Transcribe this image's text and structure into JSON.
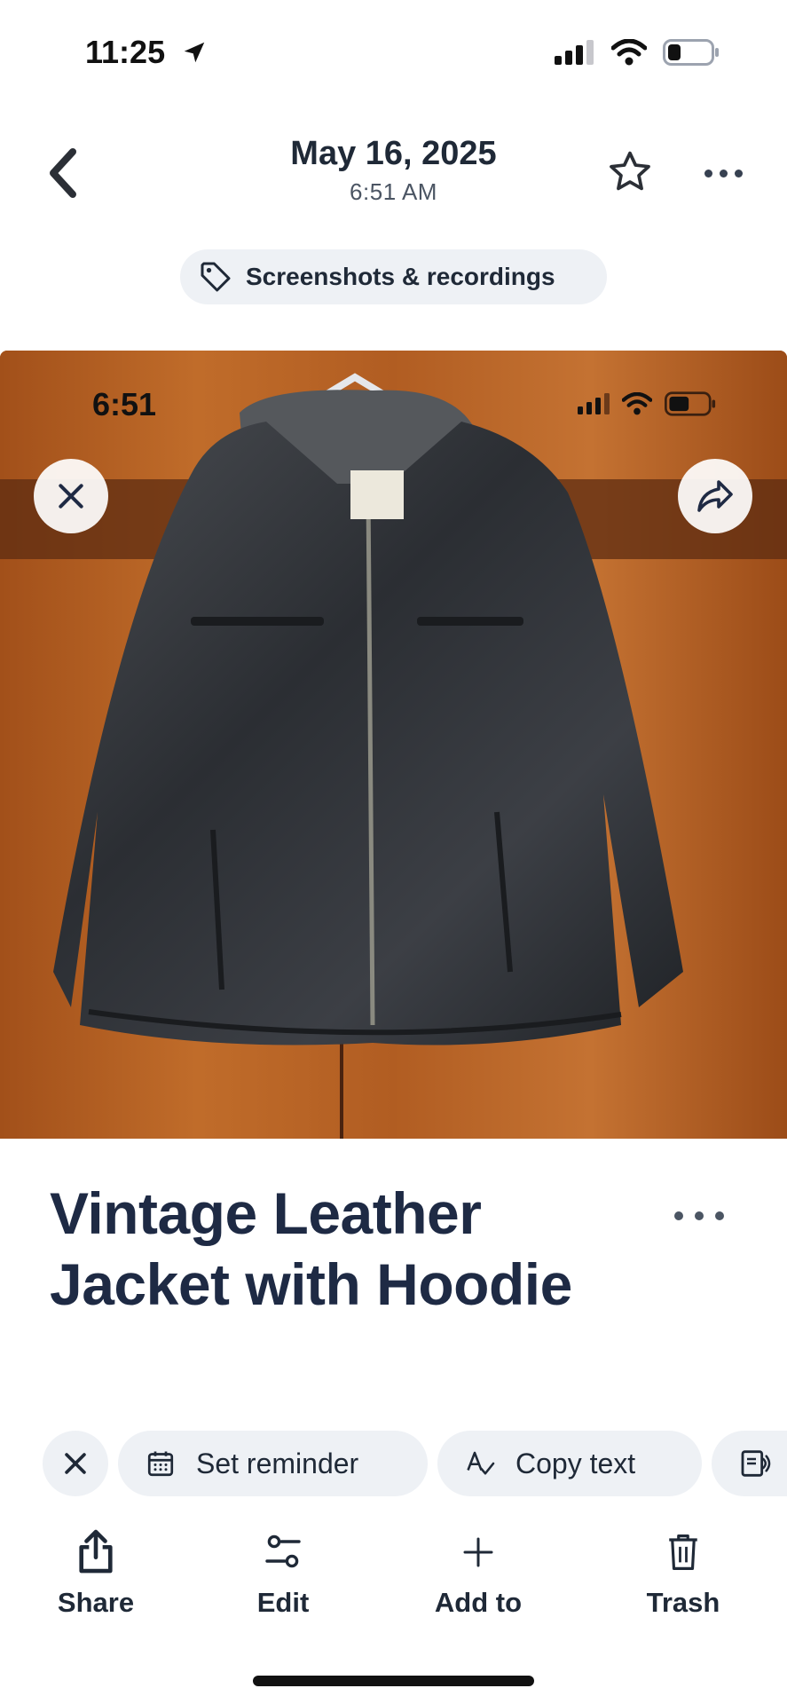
{
  "status_bar": {
    "time": "11:25",
    "icons": [
      "location-arrow-icon",
      "cellular-signal-icon",
      "wifi-icon",
      "battery-low-icon"
    ]
  },
  "header": {
    "date": "May 16, 2025",
    "time": "6:51 AM",
    "back_icon": "chevron-left-icon",
    "favorite_icon": "star-outline-icon",
    "more_icon": "ellipsis-icon"
  },
  "category": {
    "icon": "tag-icon",
    "label": "Screenshots & recordings"
  },
  "photo": {
    "embedded_status_time": "6:51",
    "close_icon": "close-icon",
    "share_icon": "share-arrow-icon",
    "colors": {
      "wood": "#b5651d",
      "jacket": "#2e3136"
    }
  },
  "details": {
    "title": "Vintage Leather Jacket with Hoodie",
    "more_icon": "ellipsis-icon"
  },
  "actions": {
    "dismiss_icon": "close-icon",
    "chips": [
      {
        "icon": "calendar-icon",
        "label": "Set reminder"
      },
      {
        "icon": "text-recognition-icon",
        "label": "Copy text"
      },
      {
        "icon": "read-aloud-icon",
        "label": ""
      }
    ]
  },
  "toolbar": {
    "items": [
      {
        "icon": "share-icon",
        "label": "Share"
      },
      {
        "icon": "edit-sliders-icon",
        "label": "Edit"
      },
      {
        "icon": "plus-icon",
        "label": "Add to"
      },
      {
        "icon": "trash-icon",
        "label": "Trash"
      }
    ]
  }
}
